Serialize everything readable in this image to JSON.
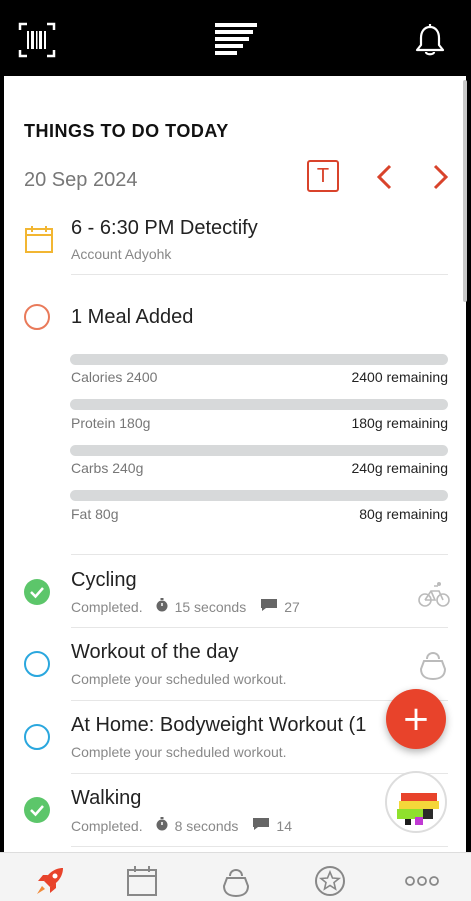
{
  "header": {
    "icons": [
      "barcode-scan-icon",
      "menu-lines-icon",
      "bell-icon"
    ]
  },
  "page": {
    "title": "THINGS TO DO TODAY",
    "date": "20 Sep 2024",
    "today_label": "T"
  },
  "event": {
    "title": "6 - 6:30 PM Detectify",
    "subtitle": "Account Adyohk"
  },
  "meal": {
    "title": "1 Meal Added",
    "macros": [
      {
        "label": "Calories 2400",
        "remaining": "2400 remaining",
        "progress": 0
      },
      {
        "label": "Protein 180g",
        "remaining": "180g remaining",
        "progress": 0
      },
      {
        "label": "Carbs 240g",
        "remaining": "240g remaining",
        "progress": 0
      },
      {
        "label": "Fat 80g",
        "remaining": "80g remaining",
        "progress": 0
      }
    ]
  },
  "activities": [
    {
      "title": "Cycling",
      "status": "Completed.",
      "duration": "15 seconds",
      "comments": "27",
      "completed": true,
      "icon": "bicycle-icon"
    },
    {
      "title": "Workout of the day",
      "subtitle": "Complete your scheduled workout.",
      "completed": false,
      "icon": "kettlebell-icon"
    },
    {
      "title": "At Home: Bodyweight Workout (1",
      "subtitle": "Complete your scheduled workout.",
      "completed": false,
      "icon": "kettlebell-icon"
    },
    {
      "title": "Walking",
      "status": "Completed.",
      "duration": "8 seconds",
      "comments": "14",
      "completed": true
    }
  ],
  "fab": {
    "label": "+"
  },
  "colors": {
    "accent": "#e8432b",
    "check_green": "#5cc66a",
    "open_blue": "#2aa7de",
    "event_yellow": "#f2b632",
    "meal_orange": "#e97a5a"
  },
  "bottom_nav": [
    "rocket-icon",
    "calendar-icon",
    "kettlebell-icon",
    "star-badge-icon",
    "more-icon"
  ]
}
